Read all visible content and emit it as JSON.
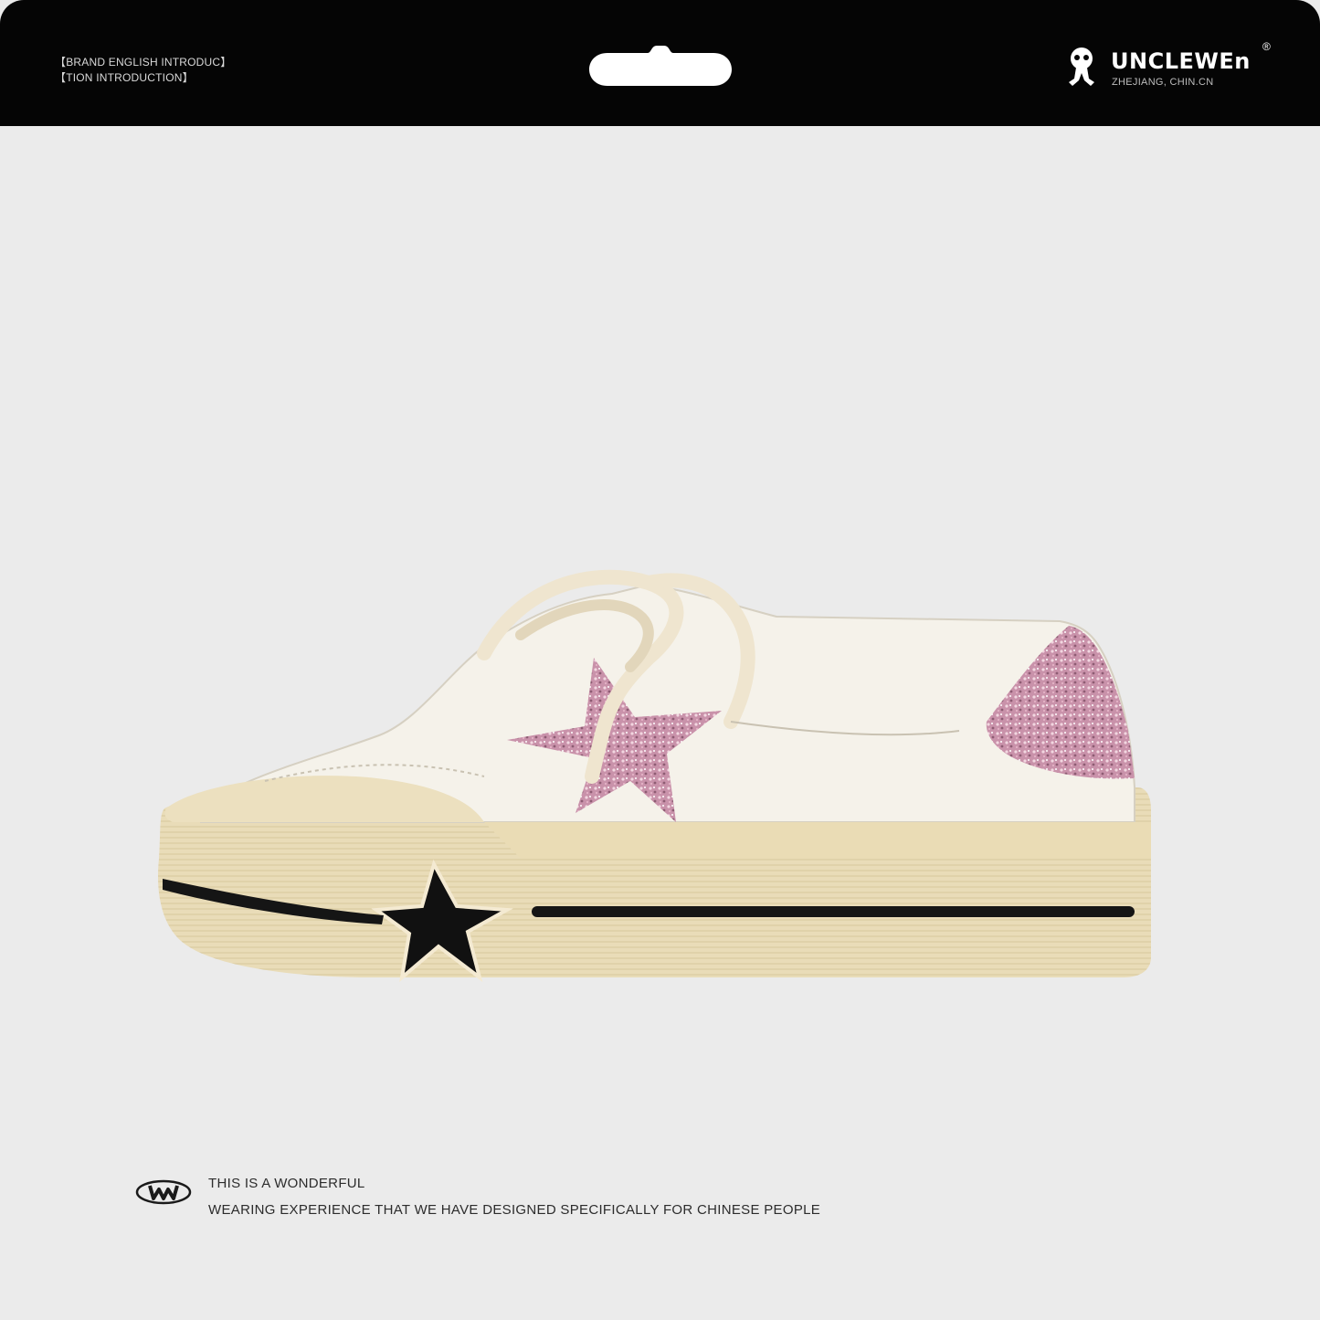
{
  "header": {
    "intro_line_1": "【BRAND ENGLISH INTRODUC】",
    "intro_line_2": "【TION INTRODUCTION】",
    "brand_name": "UNCLEWEn",
    "brand_registered": "®",
    "brand_location": "ZHEJIANG, CHIN.CN",
    "background_color": "#050505",
    "hang_tab_icon": "hang-hole-icon",
    "logo_icon": "brand-mascot-icon"
  },
  "product": {
    "image_icon": "sneaker-product-image",
    "upper_color": "#f3efe6",
    "sole_color": "#e6d9b4",
    "glitter_color": "#c48fa5",
    "accent_color": "#111111"
  },
  "footer": {
    "mark_icon": "w-emblem-icon",
    "line_1": "THIS IS A WONDERFUL",
    "line_2": "WEARING EXPERIENCE THAT WE HAVE DESIGNED SPECIFICALLY FOR CHINESE PEOPLE"
  },
  "page_background": "#ebebeb"
}
